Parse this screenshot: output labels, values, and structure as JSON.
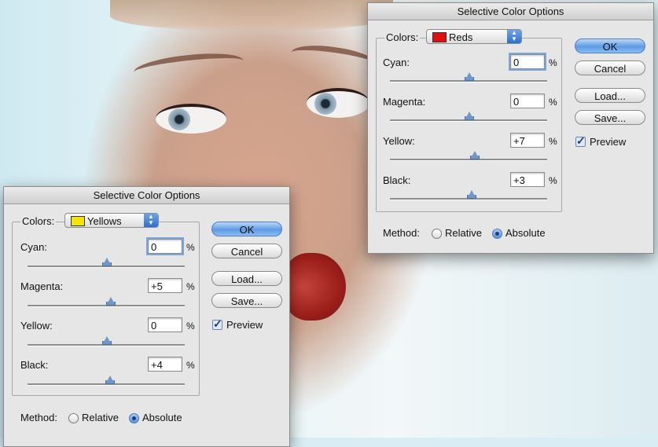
{
  "colors": {
    "reds_swatch": "#e01010",
    "yellows_swatch": "#f4e400",
    "accent": "#5d9be6"
  },
  "right_dialog": {
    "title": "Selective Color Options",
    "colors_label": "Colors:",
    "selected_color": "Reds",
    "rows": [
      {
        "label": "Cyan:",
        "value": "0",
        "unit": "%",
        "level": 0.0
      },
      {
        "label": "Magenta:",
        "value": "0",
        "unit": "%",
        "level": 0.0
      },
      {
        "label": "Yellow:",
        "value": "+7",
        "unit": "%",
        "level": 0.07
      },
      {
        "label": "Black:",
        "value": "+3",
        "unit": "%",
        "level": 0.03
      }
    ],
    "ok_label": "OK",
    "cancel_label": "Cancel",
    "load_label": "Load...",
    "save_label": "Save...",
    "preview_label": "Preview",
    "preview_checked": true,
    "method_label": "Method:",
    "relative_label": "Relative",
    "absolute_label": "Absolute",
    "method_selected": "Absolute"
  },
  "left_dialog": {
    "title": "Selective Color Options",
    "colors_label": "Colors:",
    "selected_color": "Yellows",
    "rows": [
      {
        "label": "Cyan:",
        "value": "0",
        "unit": "%",
        "level": 0.0
      },
      {
        "label": "Magenta:",
        "value": "+5",
        "unit": "%",
        "level": 0.05
      },
      {
        "label": "Yellow:",
        "value": "0",
        "unit": "%",
        "level": 0.0
      },
      {
        "label": "Black:",
        "value": "+4",
        "unit": "%",
        "level": 0.04
      }
    ],
    "ok_label": "OK",
    "cancel_label": "Cancel",
    "load_label": "Load...",
    "save_label": "Save...",
    "preview_label": "Preview",
    "preview_checked": true,
    "method_label": "Method:",
    "relative_label": "Relative",
    "absolute_label": "Absolute",
    "method_selected": "Absolute"
  }
}
